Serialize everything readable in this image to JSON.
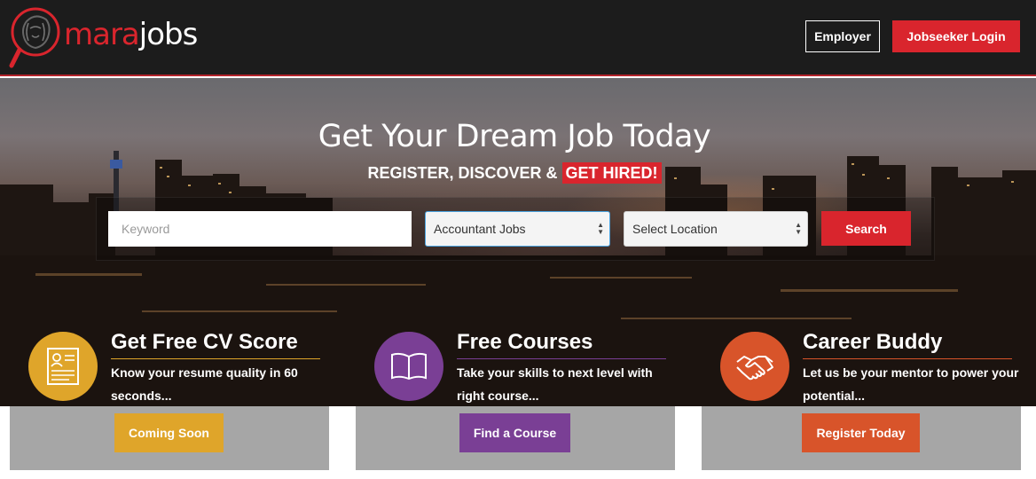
{
  "header": {
    "logo": {
      "part1": "mara",
      "part2": "jobs"
    },
    "employer_label": "Employer",
    "login_label": "Jobseeker Login"
  },
  "hero": {
    "title": "Get Your Dream Job Today",
    "subtitle_prefix": "REGISTER, DISCOVER &",
    "subtitle_highlight": "GET HIRED!"
  },
  "search": {
    "keyword_placeholder": "Keyword",
    "category_value": "Accountant Jobs",
    "location_value": "Select Location",
    "button_label": "Search"
  },
  "features": [
    {
      "title": "Get Free CV Score",
      "description": "Know your resume quality in 60 seconds...",
      "button_label": "Coming Soon",
      "color": "#dfa52a",
      "icon": "resume-icon"
    },
    {
      "title": "Free Courses",
      "description": "Take your skills to next level with right course...",
      "button_label": "Find a Course",
      "color": "#7a3f95",
      "icon": "book-icon"
    },
    {
      "title": "Career Buddy",
      "description": "Let us be your mentor to power your potential...",
      "button_label": "Register Today",
      "color": "#d8542a",
      "icon": "handshake-icon"
    }
  ],
  "colors": {
    "brand_red": "#d9252d",
    "header_bg": "#1c1c1c",
    "card_gray": "#a6a6a6"
  }
}
